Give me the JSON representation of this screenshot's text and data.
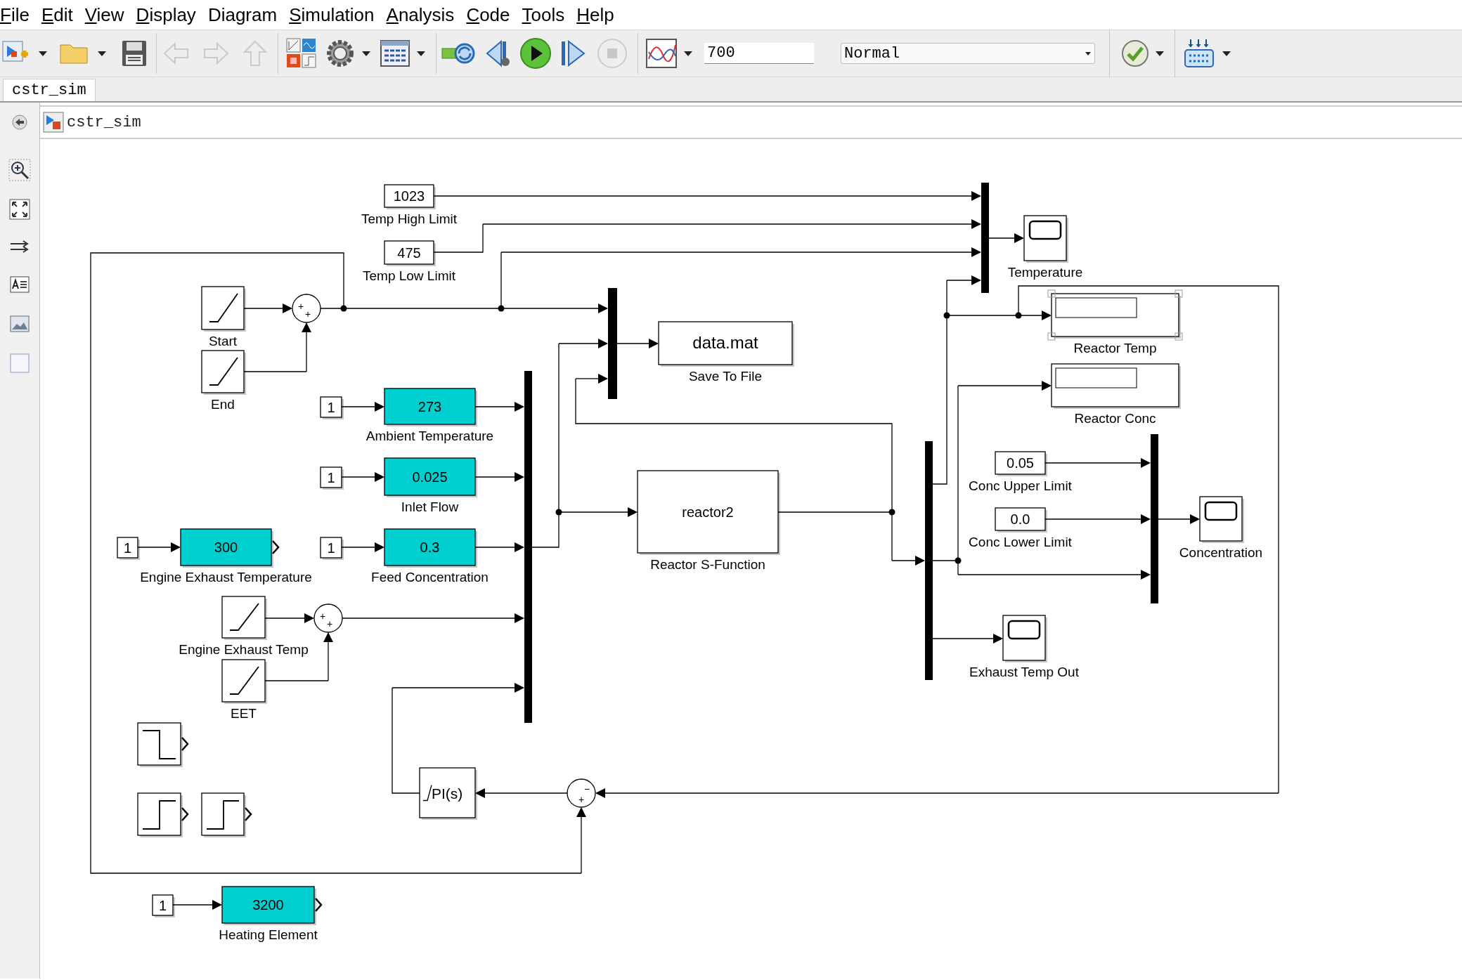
{
  "menu": [
    {
      "key": "F",
      "after": "ile"
    },
    {
      "key": "E",
      "after": "dit"
    },
    {
      "key": "V",
      "after": "iew"
    },
    {
      "key": "D",
      "after": "isplay"
    },
    {
      "before": "Dia",
      "key": "g",
      "after": "ram"
    },
    {
      "key": "S",
      "after": "imulation"
    },
    {
      "key": "A",
      "after": "nalysis"
    },
    {
      "key": "C",
      "after": "ode"
    },
    {
      "key": "T",
      "after": "ools"
    },
    {
      "key": "H",
      "after": "elp"
    }
  ],
  "toolbar": {
    "stop_time": "700",
    "sim_mode": "Normal"
  },
  "tabs": [
    {
      "label": "cstr_sim",
      "selected": true
    }
  ],
  "breadcrumb": "cstr_sim",
  "blocks": [
    {
      "kind": "constant",
      "text": "1023",
      "label": "Temp High Limit"
    },
    {
      "kind": "constant",
      "text": "475",
      "label": "Temp Low Limit"
    },
    {
      "kind": "ramp",
      "label": "Start"
    },
    {
      "kind": "ramp",
      "label": "End"
    },
    {
      "kind": "sum",
      "signs": [
        "+",
        "+"
      ]
    },
    {
      "kind": "mux"
    },
    {
      "kind": "to_file",
      "text": "data.mat",
      "label": "Save To File"
    },
    {
      "kind": "constant",
      "text": "1"
    },
    {
      "kind": "gain",
      "text": "273",
      "label": "Ambient Temperature"
    },
    {
      "kind": "constant",
      "text": "1"
    },
    {
      "kind": "gain",
      "text": "0.025",
      "label": "Inlet Flow"
    },
    {
      "kind": "constant",
      "text": "1"
    },
    {
      "kind": "gain",
      "text": "300",
      "label": "Engine Exhaust Temperature"
    },
    {
      "kind": "constant",
      "text": "1"
    },
    {
      "kind": "gain",
      "text": "0.3",
      "label": "Feed Concentration"
    },
    {
      "kind": "mux"
    },
    {
      "kind": "sfunction",
      "text": "reactor2",
      "label": "Reactor S-Function"
    },
    {
      "kind": "ramp",
      "label": "Engine Exhaust Temp"
    },
    {
      "kind": "sum",
      "signs": [
        "+",
        "+"
      ]
    },
    {
      "kind": "ramp",
      "label": "EET"
    },
    {
      "kind": "step_down"
    },
    {
      "kind": "step_up"
    },
    {
      "kind": "step_up"
    },
    {
      "kind": "pi",
      "text": "PI(s)"
    },
    {
      "kind": "sum",
      "signs": [
        "−",
        "+"
      ]
    },
    {
      "kind": "constant",
      "text": "1"
    },
    {
      "kind": "gain",
      "text": "3200",
      "label": "Heating Element"
    },
    {
      "kind": "mux"
    },
    {
      "kind": "scope",
      "label": "Temperature"
    },
    {
      "kind": "display",
      "label": "Reactor Temp",
      "selected": true
    },
    {
      "kind": "display",
      "label": "Reactor Conc",
      "selected": false
    },
    {
      "kind": "mux"
    },
    {
      "kind": "constant",
      "text": "0.05",
      "label": "Conc Upper Limit"
    },
    {
      "kind": "constant",
      "text": "0.0",
      "label": "Conc Lower Limit"
    },
    {
      "kind": "mux"
    },
    {
      "kind": "scope",
      "label": "Concentration"
    },
    {
      "kind": "scope",
      "label": "Exhaust Temp Out"
    }
  ]
}
